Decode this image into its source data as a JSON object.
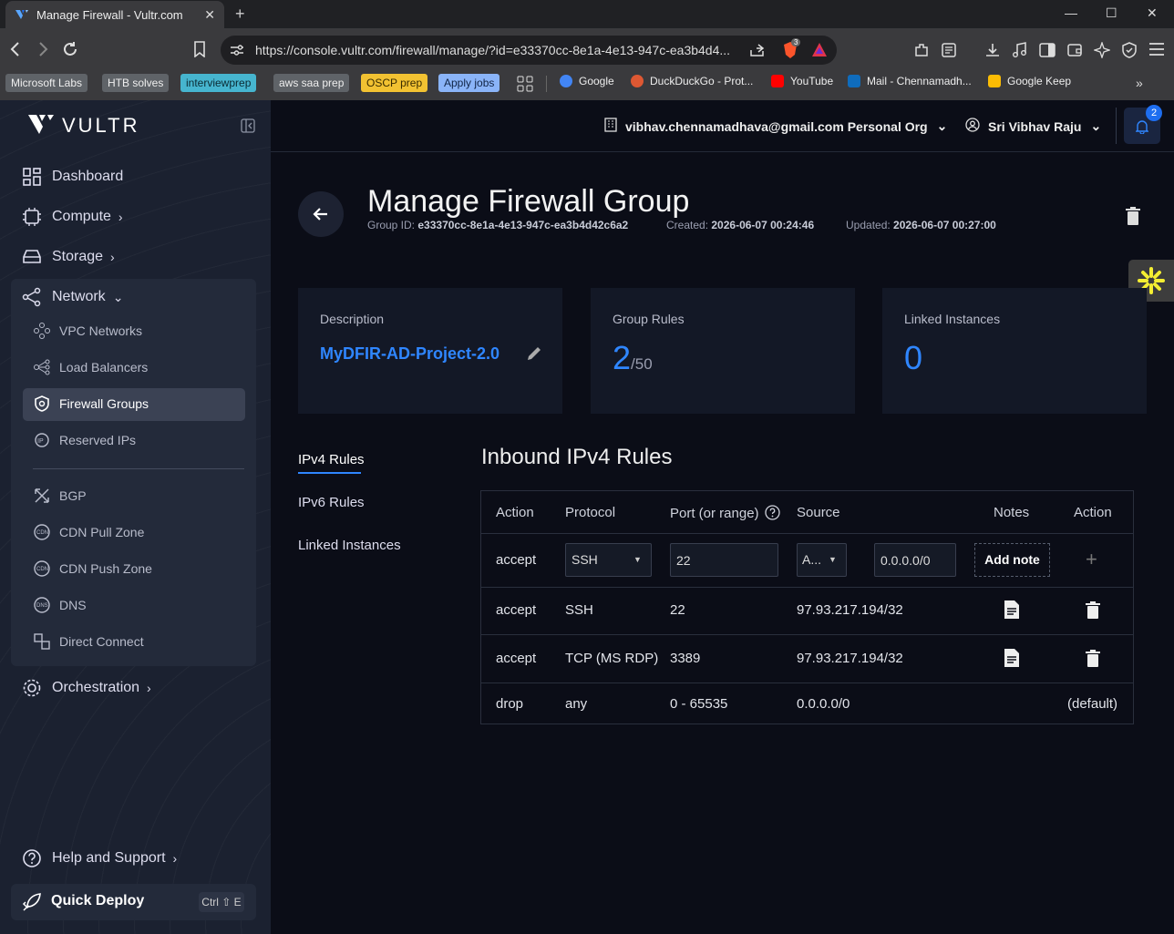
{
  "browser": {
    "tab_title": "Manage Firewall - Vultr.com",
    "url": "https://console.vultr.com/firewall/manage/?id=e33370cc-8e1a-4e13-947c-ea3b4d4...",
    "shield_count": "3",
    "bookmarks": [
      {
        "label": "Microsoft Labs",
        "color": "#5f6368",
        "text": "#eeeeee"
      },
      {
        "label": "HTB solves",
        "color": "#5f6368",
        "text": "#eeeeee"
      },
      {
        "label": "interviewprep",
        "color": "#46b5cf",
        "text": "#0b2a33"
      },
      {
        "label": "aws saa prep",
        "color": "#5f6368",
        "text": "#eeeeee"
      },
      {
        "label": "OSCP prep",
        "color": "#f2c232",
        "text": "#3a2c00"
      },
      {
        "label": "Apply jobs",
        "color": "#8ab4f8",
        "text": "#102445"
      }
    ],
    "links": [
      {
        "label": "Google",
        "color": "#4285f4"
      },
      {
        "label": "DuckDuckGo - Prot...",
        "color": "#de5833"
      },
      {
        "label": "YouTube",
        "color": "#ff0000"
      },
      {
        "label": "Mail - Chennamadh...",
        "color": "#0f6cbd"
      },
      {
        "label": "Google Keep",
        "color": "#fbbc04"
      }
    ]
  },
  "sidebar": {
    "brand": "VULTR",
    "items": {
      "dashboard": "Dashboard",
      "compute": "Compute",
      "storage": "Storage",
      "network": "Network",
      "orchestration": "Orchestration",
      "help": "Help and Support"
    },
    "network_sub": {
      "vpc": "VPC Networks",
      "lb": "Load Balancers",
      "firewall": "Firewall Groups",
      "reserved": "Reserved IPs",
      "bgp": "BGP",
      "cdn_pull": "CDN Pull Zone",
      "cdn_push": "CDN Push Zone",
      "dns": "DNS",
      "direct": "Direct Connect"
    },
    "quick_deploy": "Quick Deploy",
    "shortcut": "Ctrl ⇧ E"
  },
  "header": {
    "org": "vibhav.chennamadhava@gmail.com Personal Org",
    "user": "Sri Vibhav Raju",
    "notifications": "2"
  },
  "page": {
    "title": "Manage Firewall Group",
    "group_id_label": "Group ID:",
    "group_id": "e33370cc-8e1a-4e13-947c-ea3b4d42c6a2",
    "created_label": "Created:",
    "created": "2026-06-07 00:24:46",
    "updated_label": "Updated:",
    "updated": "2026-06-07 00:27:00"
  },
  "cards": {
    "description_label": "Description",
    "description": "MyDFIR-AD-Project-2.0",
    "rules_label": "Group Rules",
    "rules_count": "2",
    "rules_max": "/50",
    "instances_label": "Linked Instances",
    "instances_count": "0"
  },
  "tabs": {
    "ipv4": "IPv4 Rules",
    "ipv6": "IPv6 Rules",
    "linked": "Linked Instances"
  },
  "rules": {
    "title": "Inbound IPv4 Rules",
    "headers": {
      "action": "Action",
      "protocol": "Protocol",
      "port": "Port (or range)",
      "source": "Source",
      "notes": "Notes",
      "action2": "Action"
    },
    "new_rule": {
      "action": "accept",
      "protocol": "SSH",
      "port": "22",
      "source_type": "A...",
      "source_ip": "0.0.0.0/0",
      "add_note": "Add note"
    },
    "rows": [
      {
        "action": "accept",
        "protocol": "SSH",
        "port": "22",
        "source": "97.93.217.194/32"
      },
      {
        "action": "accept",
        "protocol": "TCP (MS RDP)",
        "port": "3389",
        "source": "97.93.217.194/32"
      },
      {
        "action": "drop",
        "protocol": "any",
        "port": "0 - 65535",
        "source": "0.0.0.0/0",
        "default": "(default)"
      }
    ]
  },
  "colors": {
    "accent": "#2f86ff",
    "sidebar": "#1b2130",
    "main": "#0b0d17"
  }
}
